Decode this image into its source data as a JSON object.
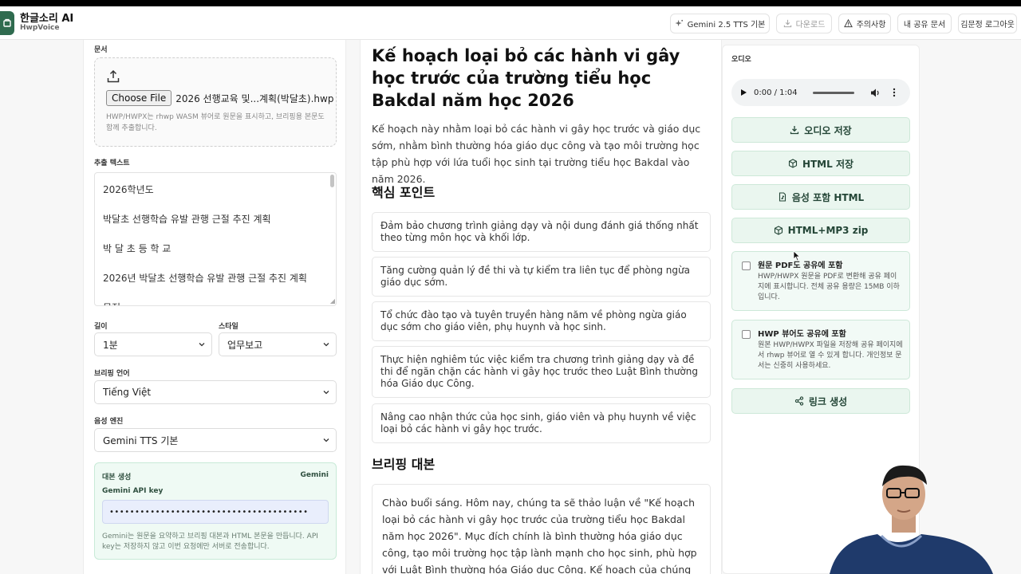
{
  "header": {
    "title": "한글소리 AI",
    "subtitle": "HwpVoice",
    "buttons": {
      "tts_model": "Gemini 2.5 TTS 기본",
      "download": "다운로드",
      "notice": "주의사항",
      "my_shared": "내 공유 문서",
      "user": "김문정 로그아웃"
    }
  },
  "left": {
    "document_label": "문서",
    "file_button": "Choose File",
    "file_name": "2026 선행교육 및...계획(박달초).hwp",
    "upload_help": "HWP/HWPX는 rhwp WASM 뷰어로 원문을 표시하고, 브리핑용 본문도 함께 추출합니다.",
    "extract_label": "추출 텍스트",
    "extract_lines": [
      "2026학년도",
      "박달초 선행학습 유발 관행 근절 추진 계획",
      "박 달 초 등 학 교",
      "2026년 박달초 선행학습 유발 관행 근절 추진 계획",
      "목적"
    ],
    "length_label": "길이",
    "length_value": "1분",
    "style_label": "스타일",
    "style_value": "업무보고",
    "language_label": "브리핑 언어",
    "language_value": "Tiếng Việt",
    "engine_label": "음성 엔진",
    "engine_value": "Gemini TTS 기본",
    "script": {
      "title": "대본 생성",
      "provider": "Gemini",
      "key_label": "Gemini API key",
      "key_value": "•••••••••••••••••••••••••••••••••••••••",
      "help": "Gemini는 원문을 요약하고 브리핑 대본과 HTML 본문을 만듭니다. API key는 저장하지 않고 이번 요청에만 서버로 전송합니다."
    }
  },
  "center": {
    "title": "Kế hoạch loại bỏ các hành vi gây học trước của trường tiểu học Bakdal năm học 2026",
    "summary": "Kế hoạch này nhằm loại bỏ các hành vi gây học trước và giáo dục sớm, nhằm bình thường hóa giáo dục công và tạo môi trường học tập phù hợp với lứa tuổi học sinh tại trường tiểu học Bakdal vào năm 2026.",
    "key_points_heading": "핵심 포인트",
    "key_points": [
      "Đảm bảo chương trình giảng dạy và nội dung đánh giá thống nhất theo từng môn học và khối lớp.",
      "Tăng cường quản lý đề thi và tự kiểm tra liên tục để phòng ngừa giáo dục sớm.",
      "Tổ chức đào tạo và tuyên truyền hàng năm về phòng ngừa giáo dục sớm cho giáo viên, phụ huynh và học sinh.",
      "Thực hiện nghiêm túc việc kiểm tra chương trình giảng dạy và đề thi để ngăn chặn các hành vi gây học trước theo Luật Bình thường hóa Giáo dục Công.",
      "Nâng cao nhận thức của học sinh, giáo viên và phụ huynh về việc loại bỏ các hành vi gây học trước."
    ],
    "briefing_heading": "브리핑 대본",
    "briefing_text": "Chào buổi sáng. Hôm nay, chúng ta sẽ thảo luận về \"Kế hoạch loại bỏ các hành vi gây học trước của trường tiểu học Bakdal năm học 2026\". Mục đích chính là bình thường hóa giáo dục công, tạo môi trường học tập lành mạnh cho học sinh, phù hợp với Luật Bình thường hóa Giáo dục Công. Kế hoạch của chúng ta tập trung vào việc đảm bảo tính nhất"
  },
  "right": {
    "audio_label": "오디오",
    "audio_time": "0:00 / 1:04",
    "buttons": {
      "save_audio": "오디오 저장",
      "save_html": "HTML 저장",
      "html_with_audio": "음성 포함 HTML",
      "html_mp3_zip": "HTML+MP3 zip",
      "create_link": "링크 생성"
    },
    "share_pdf": {
      "title": "원문 PDF도 공유에 포함",
      "desc": "HWP/HWPX 원문을 PDF로 변환해 공유 페이지에 표시합니다. 전체 공유 용량은 15MB 이하입니다."
    },
    "share_viewer": {
      "title": "HWP 뷰어도 공유에 포함",
      "desc": "원본 HWP/HWPX 파일을 저장해 공유 페이지에서 rhwp 뷰어로 열 수 있게 합니다. 개인정보 문서는 신중히 사용하세요."
    }
  },
  "colors": {
    "brand": "#2f6b4f",
    "accent_bg": "#eaf6ef",
    "accent_border": "#cde8d8"
  }
}
